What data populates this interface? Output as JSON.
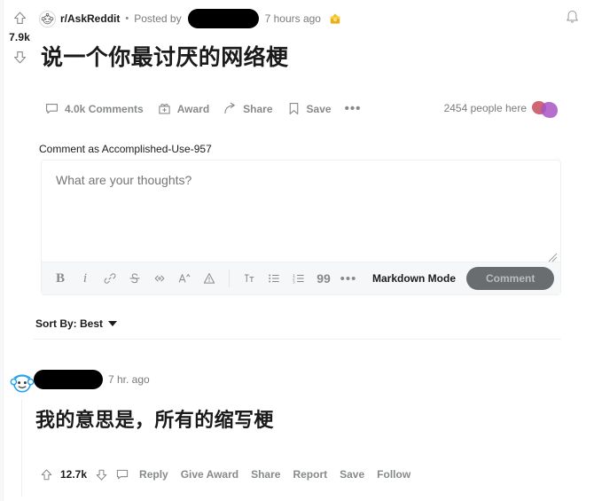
{
  "post": {
    "vote_score": "7.9k",
    "upvote_icon": "upvote-arrow-icon",
    "downvote_icon": "downvote-arrow-icon",
    "subreddit_icon": "askreddit-snoo-icon",
    "subreddit": "r/AskReddit",
    "separator": "•",
    "posted_by_label": "Posted by",
    "author_redacted": "",
    "timeago": "7 hours ago",
    "award_icon": "gold-award-icon",
    "title": "说一个你最讨厌的网络梗",
    "actions": [
      {
        "icon": "comment-bubble-icon",
        "label": "4.0k Comments"
      },
      {
        "icon": "award-gift-icon",
        "label": "Award"
      },
      {
        "icon": "share-arrow-icon",
        "label": "Share"
      },
      {
        "icon": "save-bookmark-icon",
        "label": "Save"
      },
      {
        "icon": "more-dots-icon",
        "label": ""
      }
    ],
    "people_here": "2454 people here"
  },
  "header": {
    "bell_icon": "notification-bell-icon"
  },
  "composer": {
    "comment_as": "Comment as Accomplished-Use-957",
    "placeholder": "What are your thoughts?",
    "value": "",
    "tools": [
      {
        "icon": "bold-icon",
        "glyph": "B"
      },
      {
        "icon": "italic-icon",
        "glyph": "i"
      },
      {
        "icon": "link-icon",
        "glyph": ""
      },
      {
        "icon": "strikethrough-icon",
        "glyph": ""
      },
      {
        "icon": "inline-code-icon",
        "glyph": ""
      },
      {
        "icon": "superscript-icon",
        "glyph": ""
      },
      {
        "icon": "spoiler-icon",
        "glyph": ""
      }
    ],
    "tools2": [
      {
        "icon": "heading-icon",
        "glyph": ""
      },
      {
        "icon": "bulleted-list-icon",
        "glyph": ""
      },
      {
        "icon": "numbered-list-icon",
        "glyph": ""
      },
      {
        "icon": "blockquote-icon",
        "glyph": "99"
      },
      {
        "icon": "more-dots-icon",
        "glyph": "•••"
      }
    ],
    "markdown_mode": "Markdown Mode",
    "submit_label": "Comment"
  },
  "sort": {
    "label": "Sort By: Best",
    "caret_icon": "chevron-down-icon"
  },
  "comment": {
    "avatar_icon": "user-avatar-snoo-icon",
    "author_redacted": "",
    "timeago": "7 hr. ago",
    "body": "我的意思是，所有的缩写梗",
    "score": "12.7k",
    "upvote_icon": "upvote-arrow-icon",
    "downvote_icon": "downvote-arrow-icon",
    "reply_icon": "comment-bubble-icon",
    "links": [
      "Reply",
      "Give Award",
      "Share",
      "Report",
      "Save",
      "Follow"
    ]
  },
  "colors": {
    "text_primary": "#1a1a1b",
    "text_muted": "#878a8c",
    "toolbar_bg": "#f6f7f8",
    "border": "#edeff1",
    "submit_bg": "#6a6d6f"
  }
}
